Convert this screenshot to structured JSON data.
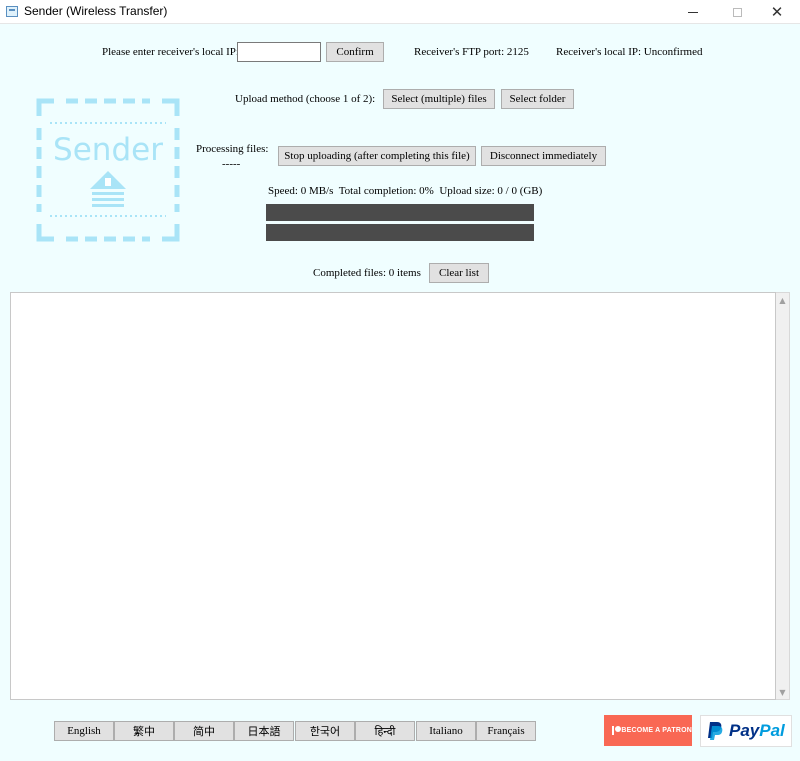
{
  "window": {
    "title": "Sender (Wireless Transfer)",
    "controls": {
      "minimize": "minimize-icon",
      "maximize": "maximize-icon",
      "close": "✕"
    }
  },
  "connection": {
    "ip_label": "Please enter receiver's local IP:",
    "ip_value": "",
    "confirm_label": "Confirm",
    "ftp_port_text": "Receiver's FTP port: 2125",
    "local_ip_status": "Receiver's local IP: Unconfirmed"
  },
  "logo": {
    "text": "Sender",
    "color": "#a9e4f7"
  },
  "upload": {
    "method_label": "Upload method (choose 1 of 2):",
    "select_files_label": "Select (multiple) files",
    "select_folder_label": "Select folder"
  },
  "processing": {
    "label": "Processing files:",
    "current_file": "-----",
    "stop_label": "Stop uploading (after completing this file)",
    "disconnect_label": "Disconnect immediately",
    "stats": "Speed: 0 MB/s  Total completion: 0%  Upload size: 0 / 0 (GB)",
    "progress_file": 0,
    "progress_total": 0
  },
  "completed": {
    "label": "Completed files: 0 items",
    "clear_label": "Clear list",
    "items": []
  },
  "languages": [
    "English",
    "繁中",
    "简中",
    "日本語",
    "한국어",
    "हिन्दी",
    "Italiano",
    "Français"
  ],
  "donate": {
    "patreon_label": "BECOME A PATRON",
    "patreon_color": "#f96854",
    "paypal_pay": "Pay",
    "paypal_pal": "Pal"
  },
  "colors": {
    "background": "#f0feff",
    "progress_bar": "#4b4b4b"
  }
}
